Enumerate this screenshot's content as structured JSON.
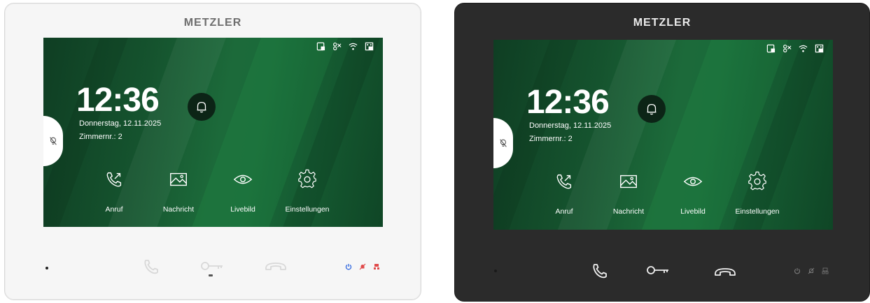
{
  "devices": [
    {
      "variant": "white",
      "brand": "METZLER",
      "screen": {
        "time": "12:36",
        "date": "Donnerstag, 12.11.2025",
        "room": "Zimmernr.: 2",
        "menu": [
          {
            "label": "Anruf",
            "icon": "phone-outgoing-icon"
          },
          {
            "label": "Nachricht",
            "icon": "image-icon"
          },
          {
            "label": "Livebild",
            "icon": "eye-icon"
          },
          {
            "label": "Einstellungen",
            "icon": "gear-icon"
          }
        ]
      },
      "indicator_colors": [
        "#3b6fe0",
        "#e04a4a",
        "#e04a4a"
      ]
    },
    {
      "variant": "black",
      "brand": "METZLER",
      "screen": {
        "time": "12:36",
        "date": "Donnerstag, 12.11.2025",
        "room": "Zimmernr.: 2",
        "menu": [
          {
            "label": "Anruf",
            "icon": "phone-outgoing-icon"
          },
          {
            "label": "Nachricht",
            "icon": "image-icon"
          },
          {
            "label": "Livebild",
            "icon": "eye-icon"
          },
          {
            "label": "Einstellungen",
            "icon": "gear-icon"
          }
        ]
      },
      "indicator_colors": [
        "#777777",
        "#777777",
        "#777777"
      ]
    }
  ],
  "colors": {
    "screen_green": "#15532e",
    "accent_green": "#1c6a3a",
    "bell_bg": "#0c2416"
  }
}
